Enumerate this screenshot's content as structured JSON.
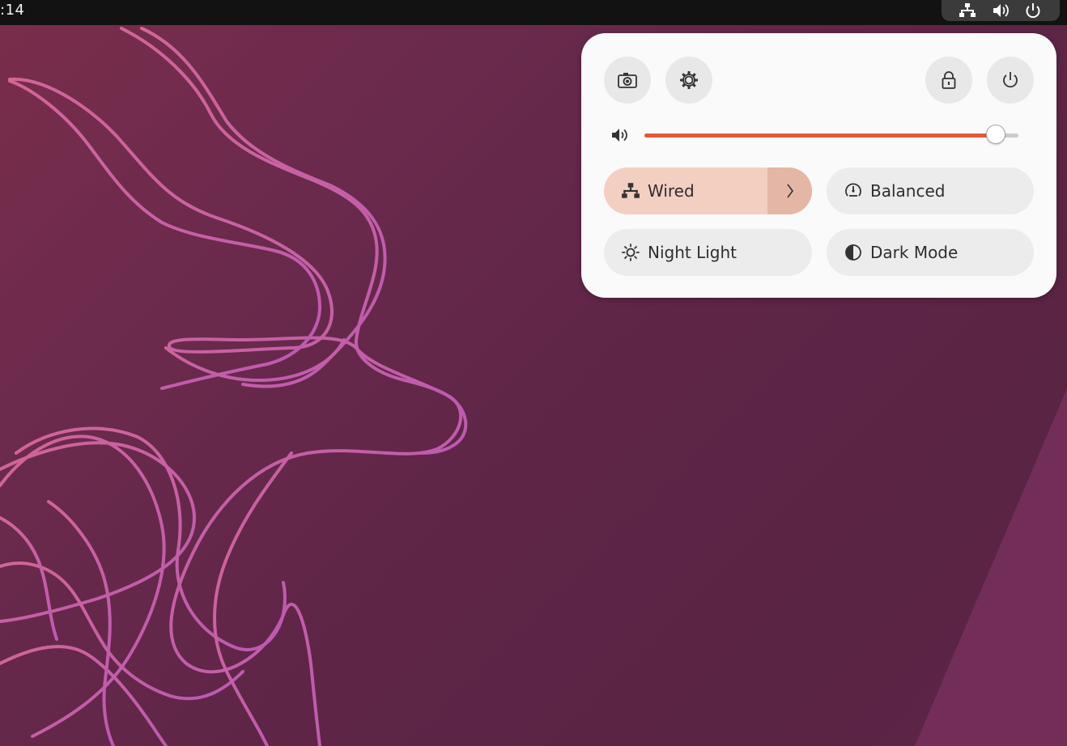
{
  "topbar": {
    "clock": ":14",
    "tray_icons": [
      "network-wired-icon",
      "volume-icon",
      "power-icon"
    ]
  },
  "quick_settings": {
    "buttons": [
      {
        "name": "screenshot",
        "icon": "camera-icon"
      },
      {
        "name": "settings",
        "icon": "gear-icon"
      },
      {
        "name": "lock",
        "icon": "lock-icon"
      },
      {
        "name": "power-off",
        "icon": "power-icon"
      }
    ],
    "volume": {
      "icon": "volume-icon",
      "level": 0.94
    },
    "toggles": {
      "wired": {
        "label": "Wired",
        "icon": "network-wired-icon",
        "active": true
      },
      "balanced": {
        "label": "Balanced",
        "icon": "power-profile-icon",
        "active": false
      },
      "night_light": {
        "label": "Night Light",
        "icon": "night-light-icon",
        "active": false
      },
      "dark_mode": {
        "label": "Dark Mode",
        "icon": "dark-mode-icon",
        "active": false
      }
    }
  },
  "colors": {
    "accent": "#e2583a",
    "active_toggle": "#f3cfc1",
    "panel_bg": "#fafafa",
    "topbar_bg": "#121212"
  }
}
